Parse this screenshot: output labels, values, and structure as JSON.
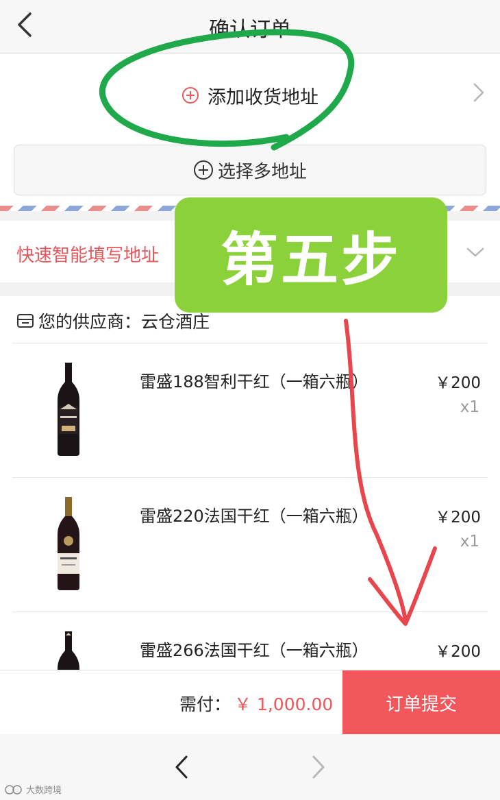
{
  "header": {
    "title": "确认订单",
    "back_icon": "chevron-left-icon"
  },
  "address": {
    "add_label": "添加收货地址",
    "add_icon": "plus-circle-icon",
    "multi_label": "选择多地址",
    "multi_icon": "plus-circle-icon"
  },
  "smart_fill": {
    "label": "快速智能填写地址"
  },
  "supplier": {
    "label": "您的供应商：云仓酒庄",
    "icon": "store-icon"
  },
  "products": [
    {
      "name": "雷盛188智利干红（一箱六瓶）",
      "price": "￥200",
      "qty": "x1"
    },
    {
      "name": "雷盛220法国干红（一箱六瓶）",
      "price": "￥200",
      "qty": "x1"
    },
    {
      "name": "雷盛266法国干红（一箱六瓶）",
      "price": "￥200",
      "qty": ""
    }
  ],
  "footer": {
    "total_label": "需付：",
    "total_value": "￥ 1,000.00",
    "submit_label": "订单提交"
  },
  "annotation": {
    "step_label": "第五步"
  },
  "watermark": {
    "text": "大数跨境"
  },
  "colors": {
    "accent_red": "#f2575b",
    "circle_green": "#1fa94a",
    "badge_green": "#8bd23a",
    "arrow_red": "#e8464d"
  }
}
